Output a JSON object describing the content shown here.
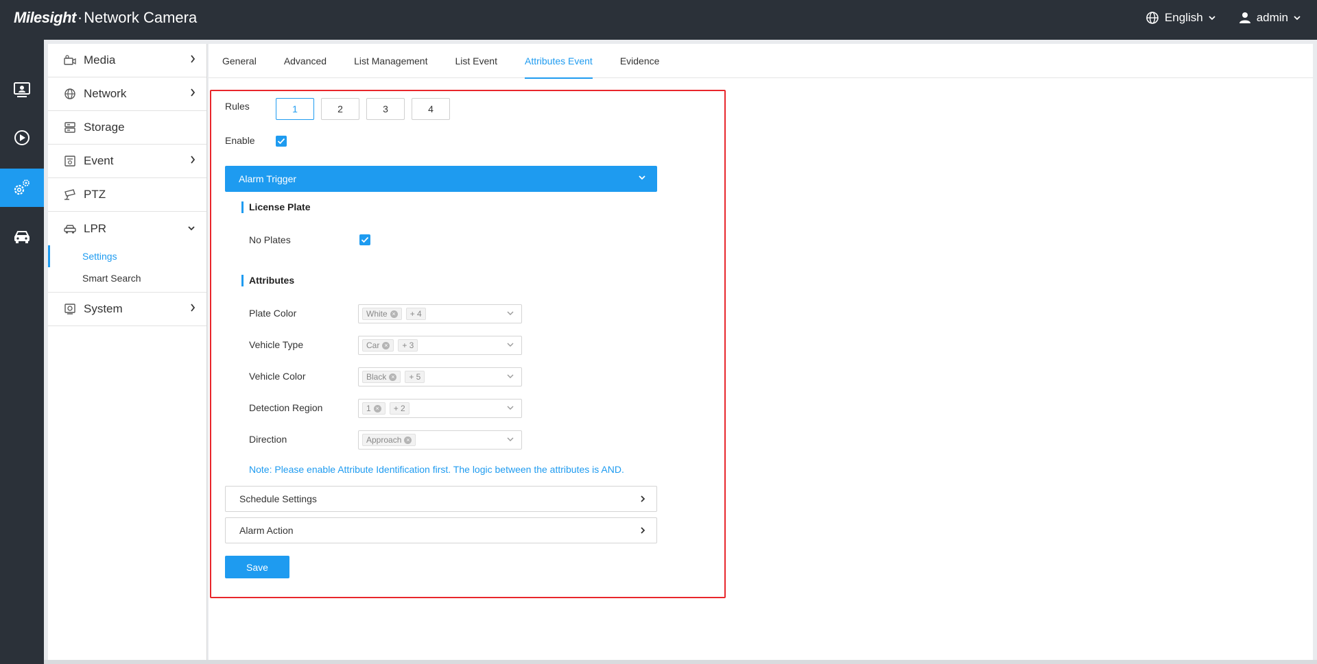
{
  "header": {
    "logo": "Milesight",
    "product": "Network Camera",
    "language": "English",
    "user": "admin"
  },
  "rail": {
    "items": [
      {
        "icon": "live-view-icon"
      },
      {
        "icon": "playback-icon"
      },
      {
        "icon": "settings-icon"
      },
      {
        "icon": "vehicle-icon"
      }
    ]
  },
  "sidebar": {
    "items": [
      {
        "label": "Media",
        "icon": "camera-icon"
      },
      {
        "label": "Network",
        "icon": "globe-icon"
      },
      {
        "label": "Storage",
        "icon": "storage-icon"
      },
      {
        "label": "Event",
        "icon": "event-icon"
      },
      {
        "label": "PTZ",
        "icon": "ptz-icon"
      },
      {
        "label": "LPR",
        "icon": "car-icon"
      },
      {
        "label": "System",
        "icon": "system-icon"
      }
    ],
    "lpr_sub": [
      "Settings",
      "Smart Search"
    ]
  },
  "tabs": [
    "General",
    "Advanced",
    "List Management",
    "List Event",
    "Attributes Event",
    "Evidence"
  ],
  "form": {
    "rules_label": "Rules",
    "rules": [
      "1",
      "2",
      "3",
      "4"
    ],
    "enable_label": "Enable",
    "alarm_trigger": "Alarm Trigger",
    "license_plate_title": "License Plate",
    "no_plates_label": "No Plates",
    "attributes_title": "Attributes",
    "fields": [
      {
        "label": "Plate Color",
        "tag": "White",
        "more": "+ 4"
      },
      {
        "label": "Vehicle Type",
        "tag": "Car",
        "more": "+ 3"
      },
      {
        "label": "Vehicle Color",
        "tag": "Black",
        "more": "+ 5"
      },
      {
        "label": "Detection Region",
        "tag": "1",
        "more": "+ 2"
      },
      {
        "label": "Direction",
        "tag": "Approach",
        "more": ""
      }
    ],
    "note": "Note: Please enable Attribute Identification first. The logic between the attributes is AND.",
    "schedule_settings": "Schedule Settings",
    "alarm_action": "Alarm Action",
    "save": "Save"
  },
  "colors": {
    "accent": "#1e9bf0",
    "topbar": "#2b3139",
    "highlight": "#e8262b"
  }
}
